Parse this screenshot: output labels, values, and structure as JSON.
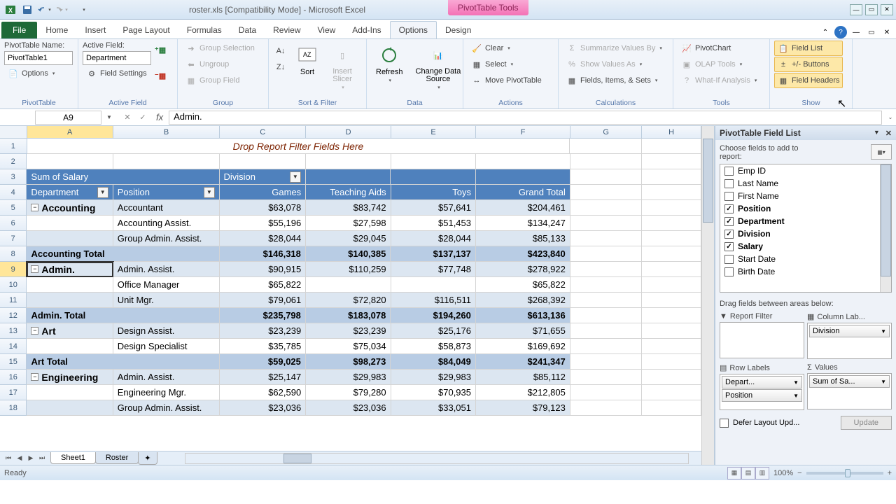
{
  "title": "roster.xls  [Compatibility Mode] - Microsoft Excel",
  "context_tab": "PivotTable Tools",
  "tabs": {
    "file": "File",
    "home": "Home",
    "insert": "Insert",
    "page_layout": "Page Layout",
    "formulas": "Formulas",
    "data": "Data",
    "review": "Review",
    "view": "View",
    "addins": "Add-Ins",
    "options": "Options",
    "design": "Design"
  },
  "name_box": "A9",
  "formula": "Admin.",
  "ribbon": {
    "pivottable": {
      "name_label": "PivotTable Name:",
      "name_value": "PivotTable1",
      "options": "Options",
      "group": "PivotTable"
    },
    "active_field": {
      "label": "Active Field:",
      "value": "Department",
      "settings": "Field Settings",
      "group": "Active Field"
    },
    "group": {
      "sel": "Group Selection",
      "ungroup": "Ungroup",
      "field": "Group Field",
      "group": "Group"
    },
    "sort_filter": {
      "sort": "Sort",
      "slicer": "Insert\nSlicer",
      "group": "Sort & Filter"
    },
    "data": {
      "refresh": "Refresh",
      "change": "Change Data\nSource",
      "group": "Data"
    },
    "actions": {
      "clear": "Clear",
      "select": "Select",
      "move": "Move PivotTable",
      "group": "Actions"
    },
    "calc": {
      "summarize": "Summarize Values By",
      "show": "Show Values As",
      "fields": "Fields, Items, & Sets",
      "group": "Calculations"
    },
    "tools": {
      "chart": "PivotChart",
      "olap": "OLAP Tools",
      "whatif": "What-If Analysis",
      "group": "Tools"
    },
    "show": {
      "fieldlist": "Field List",
      "buttons": "+/- Buttons",
      "headers": "Field Headers",
      "group": "Show"
    }
  },
  "columns": [
    "A",
    "B",
    "C",
    "D",
    "E",
    "F",
    "G",
    "H"
  ],
  "drop_filter": "Drop Report Filter Fields Here",
  "pt": {
    "sum_label": "Sum of Salary",
    "division": "Division",
    "department": "Department",
    "position": "Position",
    "col_games": "Games",
    "col_teach": "Teaching Aids",
    "col_toys": "Toys",
    "col_gt": "Grand Total"
  },
  "rows": [
    {
      "n": 5,
      "dept": "Accounting",
      "pos": "Accountant",
      "g": "$63,078",
      "t": "$83,742",
      "y": "$57,641",
      "gt": "$204,461",
      "cls": "pt-row-lbl"
    },
    {
      "n": 6,
      "dept": "",
      "pos": "Accounting Assist.",
      "g": "$55,196",
      "t": "$27,598",
      "y": "$51,453",
      "gt": "$134,247",
      "cls": "pt-cell"
    },
    {
      "n": 7,
      "dept": "",
      "pos": "Group Admin. Assist.",
      "g": "$28,044",
      "t": "$29,045",
      "y": "$28,044",
      "gt": "$85,133",
      "cls": "pt-row-lbl"
    },
    {
      "n": 8,
      "dept": "Accounting Total",
      "pos": "",
      "g": "$146,318",
      "t": "$140,385",
      "y": "$137,137",
      "gt": "$423,840",
      "cls": "pt-total",
      "total": true
    },
    {
      "n": 9,
      "dept": "Admin.",
      "pos": "Admin. Assist.",
      "g": "$90,915",
      "t": "$110,259",
      "y": "$77,748",
      "gt": "$278,922",
      "cls": "pt-row-lbl",
      "active": true
    },
    {
      "n": 10,
      "dept": "",
      "pos": "Office Manager",
      "g": "$65,822",
      "t": "",
      "y": "",
      "gt": "$65,822",
      "cls": "pt-cell"
    },
    {
      "n": 11,
      "dept": "",
      "pos": "Unit Mgr.",
      "g": "$79,061",
      "t": "$72,820",
      "y": "$116,511",
      "gt": "$268,392",
      "cls": "pt-row-lbl"
    },
    {
      "n": 12,
      "dept": "Admin. Total",
      "pos": "",
      "g": "$235,798",
      "t": "$183,078",
      "y": "$194,260",
      "gt": "$613,136",
      "cls": "pt-total",
      "total": true
    },
    {
      "n": 13,
      "dept": "Art",
      "pos": "Design Assist.",
      "g": "$23,239",
      "t": "$23,239",
      "y": "$25,176",
      "gt": "$71,655",
      "cls": "pt-row-lbl"
    },
    {
      "n": 14,
      "dept": "",
      "pos": "Design Specialist",
      "g": "$35,785",
      "t": "$75,034",
      "y": "$58,873",
      "gt": "$169,692",
      "cls": "pt-cell"
    },
    {
      "n": 15,
      "dept": "Art Total",
      "pos": "",
      "g": "$59,025",
      "t": "$98,273",
      "y": "$84,049",
      "gt": "$241,347",
      "cls": "pt-total",
      "total": true
    },
    {
      "n": 16,
      "dept": "Engineering",
      "pos": "Admin. Assist.",
      "g": "$25,147",
      "t": "$29,983",
      "y": "$29,983",
      "gt": "$85,112",
      "cls": "pt-row-lbl"
    },
    {
      "n": 17,
      "dept": "",
      "pos": "Engineering Mgr.",
      "g": "$62,590",
      "t": "$79,280",
      "y": "$70,935",
      "gt": "$212,805",
      "cls": "pt-cell"
    },
    {
      "n": 18,
      "dept": "",
      "pos": "Group Admin. Assist.",
      "g": "$23,036",
      "t": "$23,036",
      "y": "$33,051",
      "gt": "$79,123",
      "cls": "pt-row-lbl"
    }
  ],
  "sheets": {
    "s1": "Sheet1",
    "s2": "Roster"
  },
  "status": "Ready",
  "zoom": "100%",
  "field_list": {
    "title": "PivotTable Field List",
    "instruct": "Choose fields to add to report:",
    "fields": [
      {
        "name": "Emp ID",
        "checked": false
      },
      {
        "name": "Last Name",
        "checked": false
      },
      {
        "name": "First Name",
        "checked": false
      },
      {
        "name": "Position",
        "checked": true
      },
      {
        "name": "Department",
        "checked": true
      },
      {
        "name": "Division",
        "checked": true
      },
      {
        "name": "Salary",
        "checked": true
      },
      {
        "name": "Start Date",
        "checked": false
      },
      {
        "name": "Birth Date",
        "checked": false
      }
    ],
    "drag": "Drag fields between areas below:",
    "areas": {
      "filter": "Report Filter",
      "columns": "Column Lab...",
      "rows": "Row Labels",
      "values": "Values"
    },
    "pills": {
      "division": "Division",
      "dept": "Depart...",
      "pos": "Position",
      "sum": "Sum of Sa..."
    },
    "defer": "Defer Layout Upd...",
    "update": "Update"
  }
}
